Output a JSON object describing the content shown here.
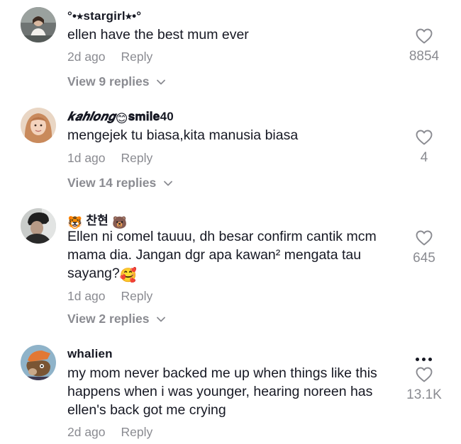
{
  "comments": [
    {
      "username": "°•⭒stargirl⭒•°",
      "text": "ellen have the best mum ever",
      "time": "2d ago",
      "reply_label": "Reply",
      "likes": "8854",
      "view_replies": "View 9 replies"
    },
    {
      "username_prefix": "𝒌𝒂𝒉𝒍𝒐𝒏𝒈",
      "username_emoji": "😊",
      "username_suffix": "𝐬𝐦𝐢𝐥𝐞40",
      "text": "mengejek tu biasa,kita manusia biasa",
      "time": "1d ago",
      "reply_label": "Reply",
      "likes": "4",
      "view_replies": "View 14 replies"
    },
    {
      "username_emoji_left": "🐯",
      "username": "찬현",
      "username_emoji_right": "🐻",
      "text_lines": [
        "Ellen ni comel tauuu, dh besar confirm cantik mcm",
        "mama dia. Jangan dgr apa kawan² mengata tau",
        "sayang?"
      ],
      "text_emoji": "🥰",
      "time": "1d ago",
      "reply_label": "Reply",
      "likes": "645",
      "view_replies": "View 2 replies"
    },
    {
      "username": "whalien",
      "text_lines": [
        "my mom never backed me up when things like this",
        "happens when i was younger, hearing noreen has",
        "ellen's back got me crying"
      ],
      "time": "2d ago",
      "reply_label": "Reply",
      "likes": "13.1K"
    }
  ],
  "icons": {
    "heart": "heart-outline-icon",
    "chevron": "chevron-down-icon",
    "more": "more-options-icon"
  },
  "colors": {
    "text": "#161823",
    "muted": "#8a8b91"
  }
}
